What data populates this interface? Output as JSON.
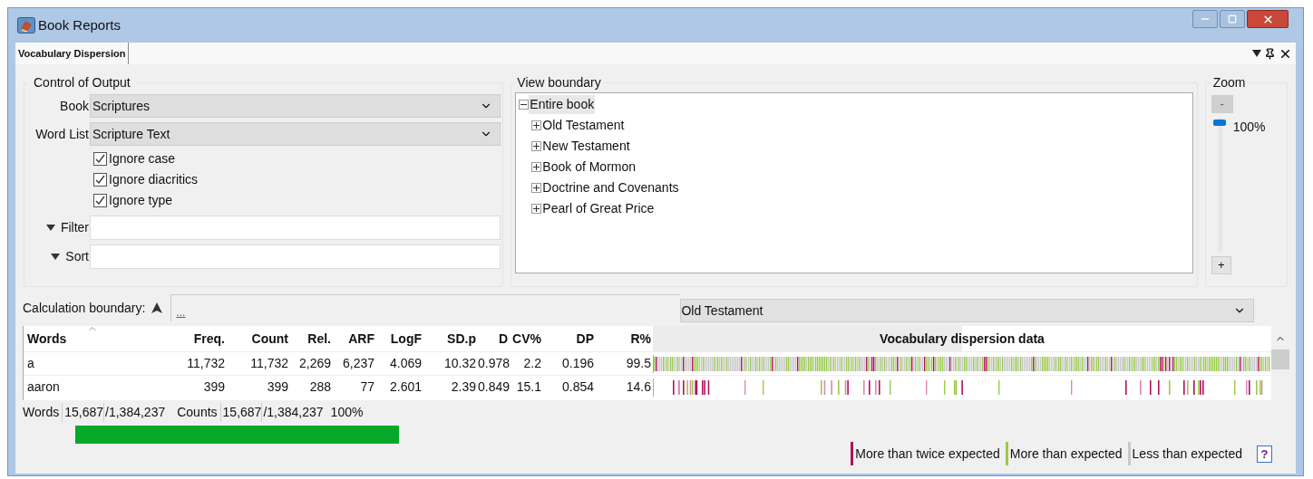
{
  "window": {
    "title": "Book Reports"
  },
  "tabs": [
    {
      "label": "Vocabulary Dispersion",
      "selected": true
    }
  ],
  "control_of_output": {
    "title": "Control of Output",
    "book": {
      "label": "Book",
      "value": "Scriptures"
    },
    "word_list": {
      "label": "Word List",
      "value": "Scripture Text"
    },
    "options": [
      {
        "label": "Ignore case",
        "checked": true
      },
      {
        "label": "Ignore diacritics",
        "checked": true
      },
      {
        "label": "Ignore type",
        "checked": true
      }
    ],
    "filter": {
      "label": "Filter"
    },
    "sort": {
      "label": "Sort"
    }
  },
  "view_boundary": {
    "title": "View boundary",
    "tree": [
      {
        "label": "Entire book",
        "expanded": true,
        "selected": true,
        "children": [
          {
            "label": "Old Testament",
            "expanded": false
          },
          {
            "label": "New Testament",
            "expanded": false
          },
          {
            "label": "Book of Mormon",
            "expanded": false
          },
          {
            "label": "Doctrine and Covenants",
            "expanded": false
          },
          {
            "label": "Pearl of Great Price",
            "expanded": false
          }
        ]
      }
    ]
  },
  "zoom": {
    "title": "Zoom",
    "minus": "-",
    "plus": "+",
    "level": 1,
    "reading": "100%"
  },
  "calculation_boundary": {
    "label": "Calculation boundary:",
    "link": "...",
    "value": "Old Testament"
  },
  "table": {
    "columns": [
      "Words",
      "Freq.",
      "Count",
      "Rel.",
      "ARF",
      "LogF",
      "SD.p",
      "D",
      "CV%",
      "DP",
      "R%",
      "Vocabulary dispersion data"
    ],
    "rows": [
      {
        "cells": [
          "a",
          "11,732",
          "11,732",
          "2,269",
          "6,237",
          "4.069",
          "10.32",
          "0.978",
          "2.2",
          "0.196",
          "99.5"
        ]
      },
      {
        "cells": [
          "aaron",
          "399",
          "399",
          "288",
          "77",
          "2.601",
          "2.39",
          "0.849",
          "15.1",
          "0.854",
          "14.6"
        ]
      }
    ]
  },
  "summary": {
    "words_label": "Words",
    "words": "15,687",
    "words_sep": "/",
    "words_total": "1,384,237",
    "counts_label": "Counts",
    "counts": "15,687",
    "counts_sep": "/",
    "counts_total": "1,384,237",
    "percent": "100%"
  },
  "legend": [
    {
      "label": "More than twice expected",
      "color": "#b0125e"
    },
    {
      "label": "More than expected",
      "color": "#9acb4a"
    },
    {
      "label": "Less than expected",
      "color": "#c8c8c8"
    }
  ],
  "help": "?"
}
